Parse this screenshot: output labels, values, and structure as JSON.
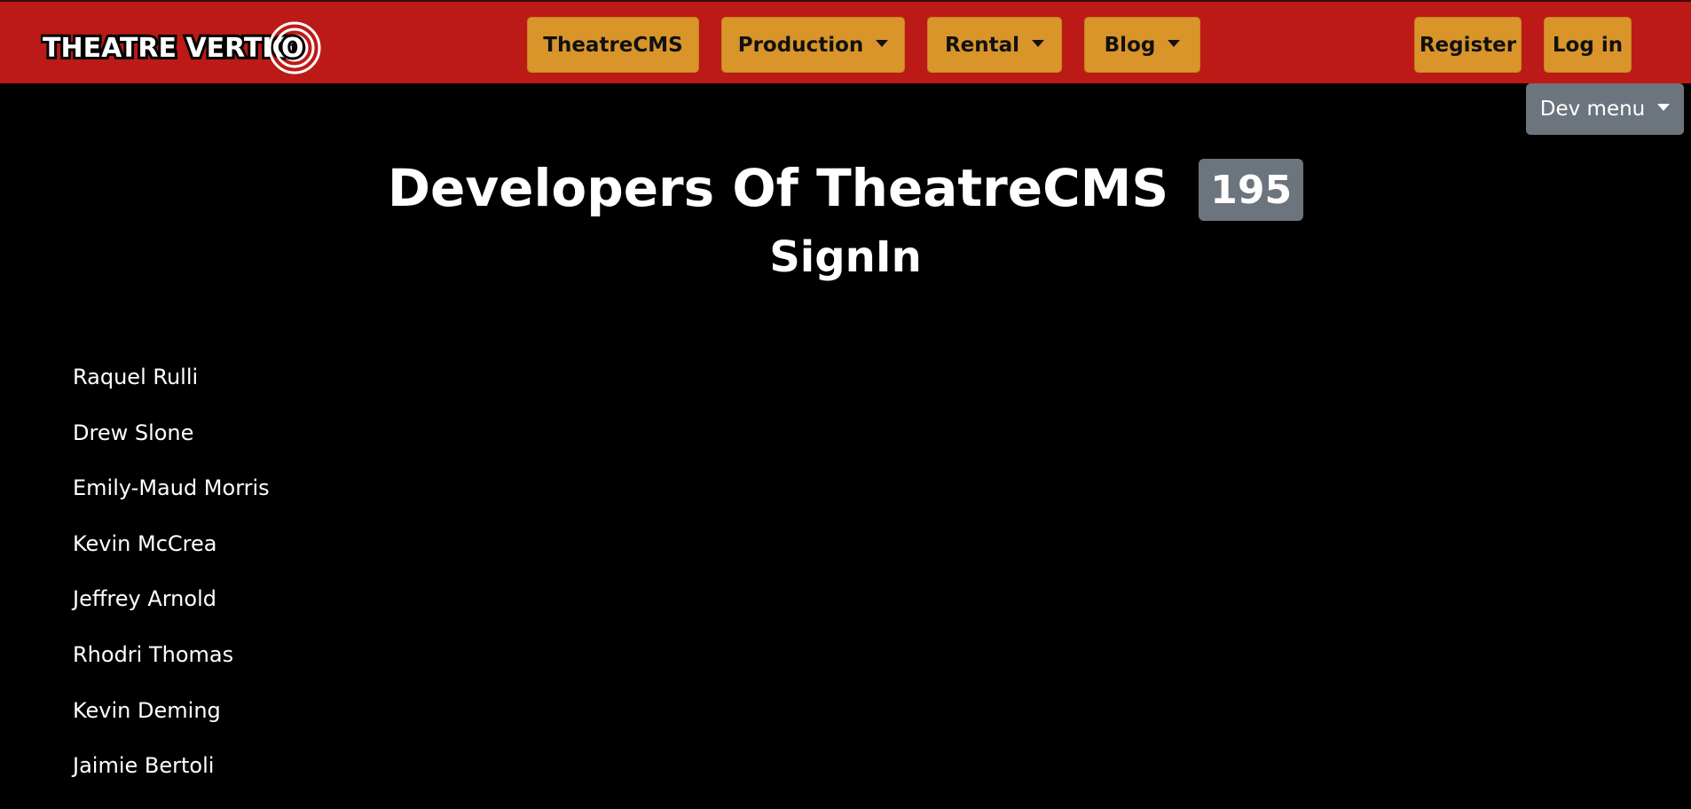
{
  "header": {
    "logo_text": "THEATRE VERTIGO",
    "nav": [
      {
        "label": "TheatreCMS",
        "dropdown": false
      },
      {
        "label": "Production",
        "dropdown": true
      },
      {
        "label": "Rental",
        "dropdown": true
      },
      {
        "label": "Blog",
        "dropdown": true
      }
    ],
    "register_label": "Register",
    "login_label": "Log in"
  },
  "dev_menu": {
    "label": "Dev menu"
  },
  "main": {
    "title": "Developers Of TheatreCMS",
    "count": "195",
    "subtitle": "SignIn",
    "developers": [
      "Raquel Rulli",
      "Drew Slone",
      "Emily-Maud Morris",
      "Kevin McCrea",
      "Jeffrey Arnold",
      "Rhodri Thomas",
      "Kevin Deming",
      "Jaimie Bertoli"
    ]
  },
  "colors": {
    "header_bg": "#bc1a16",
    "nav_button": "#d9952a",
    "page_bg": "#000000",
    "badge_bg": "#6c757d",
    "text": "#ffffff"
  }
}
